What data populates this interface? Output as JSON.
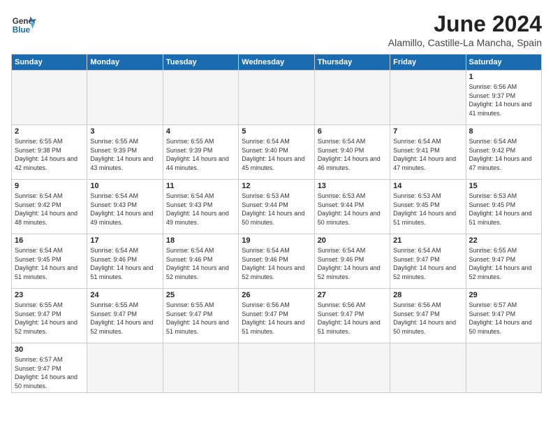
{
  "logo": {
    "text_general": "General",
    "text_blue": "Blue"
  },
  "header": {
    "month_year": "June 2024",
    "location": "Alamillo, Castille-La Mancha, Spain"
  },
  "weekdays": [
    "Sunday",
    "Monday",
    "Tuesday",
    "Wednesday",
    "Thursday",
    "Friday",
    "Saturday"
  ],
  "weeks": [
    [
      {
        "day": "",
        "empty": true
      },
      {
        "day": "",
        "empty": true
      },
      {
        "day": "",
        "empty": true
      },
      {
        "day": "",
        "empty": true
      },
      {
        "day": "",
        "empty": true
      },
      {
        "day": "",
        "empty": true
      },
      {
        "day": "1",
        "sunrise": "6:56 AM",
        "sunset": "9:37 PM",
        "daylight": "14 hours and 41 minutes."
      }
    ],
    [
      {
        "day": "2",
        "sunrise": "6:55 AM",
        "sunset": "9:38 PM",
        "daylight": "14 hours and 42 minutes."
      },
      {
        "day": "3",
        "sunrise": "6:55 AM",
        "sunset": "9:39 PM",
        "daylight": "14 hours and 43 minutes."
      },
      {
        "day": "4",
        "sunrise": "6:55 AM",
        "sunset": "9:39 PM",
        "daylight": "14 hours and 44 minutes."
      },
      {
        "day": "5",
        "sunrise": "6:54 AM",
        "sunset": "9:40 PM",
        "daylight": "14 hours and 45 minutes."
      },
      {
        "day": "6",
        "sunrise": "6:54 AM",
        "sunset": "9:40 PM",
        "daylight": "14 hours and 46 minutes."
      },
      {
        "day": "7",
        "sunrise": "6:54 AM",
        "sunset": "9:41 PM",
        "daylight": "14 hours and 47 minutes."
      },
      {
        "day": "8",
        "sunrise": "6:54 AM",
        "sunset": "9:42 PM",
        "daylight": "14 hours and 47 minutes."
      }
    ],
    [
      {
        "day": "9",
        "sunrise": "6:54 AM",
        "sunset": "9:42 PM",
        "daylight": "14 hours and 48 minutes."
      },
      {
        "day": "10",
        "sunrise": "6:54 AM",
        "sunset": "9:43 PM",
        "daylight": "14 hours and 49 minutes."
      },
      {
        "day": "11",
        "sunrise": "6:54 AM",
        "sunset": "9:43 PM",
        "daylight": "14 hours and 49 minutes."
      },
      {
        "day": "12",
        "sunrise": "6:53 AM",
        "sunset": "9:44 PM",
        "daylight": "14 hours and 50 minutes."
      },
      {
        "day": "13",
        "sunrise": "6:53 AM",
        "sunset": "9:44 PM",
        "daylight": "14 hours and 50 minutes."
      },
      {
        "day": "14",
        "sunrise": "6:53 AM",
        "sunset": "9:45 PM",
        "daylight": "14 hours and 51 minutes."
      },
      {
        "day": "15",
        "sunrise": "6:53 AM",
        "sunset": "9:45 PM",
        "daylight": "14 hours and 51 minutes."
      }
    ],
    [
      {
        "day": "16",
        "sunrise": "6:54 AM",
        "sunset": "9:45 PM",
        "daylight": "14 hours and 51 minutes."
      },
      {
        "day": "17",
        "sunrise": "6:54 AM",
        "sunset": "9:46 PM",
        "daylight": "14 hours and 51 minutes."
      },
      {
        "day": "18",
        "sunrise": "6:54 AM",
        "sunset": "9:46 PM",
        "daylight": "14 hours and 52 minutes."
      },
      {
        "day": "19",
        "sunrise": "6:54 AM",
        "sunset": "9:46 PM",
        "daylight": "14 hours and 52 minutes."
      },
      {
        "day": "20",
        "sunrise": "6:54 AM",
        "sunset": "9:46 PM",
        "daylight": "14 hours and 52 minutes."
      },
      {
        "day": "21",
        "sunrise": "6:54 AM",
        "sunset": "9:47 PM",
        "daylight": "14 hours and 52 minutes."
      },
      {
        "day": "22",
        "sunrise": "6:55 AM",
        "sunset": "9:47 PM",
        "daylight": "14 hours and 52 minutes."
      }
    ],
    [
      {
        "day": "23",
        "sunrise": "6:55 AM",
        "sunset": "9:47 PM",
        "daylight": "14 hours and 52 minutes."
      },
      {
        "day": "24",
        "sunrise": "6:55 AM",
        "sunset": "9:47 PM",
        "daylight": "14 hours and 52 minutes."
      },
      {
        "day": "25",
        "sunrise": "6:55 AM",
        "sunset": "9:47 PM",
        "daylight": "14 hours and 51 minutes."
      },
      {
        "day": "26",
        "sunrise": "6:56 AM",
        "sunset": "9:47 PM",
        "daylight": "14 hours and 51 minutes."
      },
      {
        "day": "27",
        "sunrise": "6:56 AM",
        "sunset": "9:47 PM",
        "daylight": "14 hours and 51 minutes."
      },
      {
        "day": "28",
        "sunrise": "6:56 AM",
        "sunset": "9:47 PM",
        "daylight": "14 hours and 50 minutes."
      },
      {
        "day": "29",
        "sunrise": "6:57 AM",
        "sunset": "9:47 PM",
        "daylight": "14 hours and 50 minutes."
      }
    ],
    [
      {
        "day": "30",
        "sunrise": "6:57 AM",
        "sunset": "9:47 PM",
        "daylight": "14 hours and 50 minutes."
      },
      {
        "day": "",
        "empty": true
      },
      {
        "day": "",
        "empty": true
      },
      {
        "day": "",
        "empty": true
      },
      {
        "day": "",
        "empty": true
      },
      {
        "day": "",
        "empty": true
      },
      {
        "day": "",
        "empty": true
      }
    ]
  ]
}
